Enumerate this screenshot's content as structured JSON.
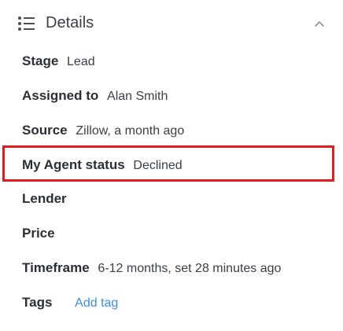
{
  "header": {
    "title": "Details",
    "list_icon": "list-icon",
    "collapse_icon": "chevron-up-icon"
  },
  "fields": {
    "stage": {
      "label": "Stage",
      "value": "Lead"
    },
    "assigned_to": {
      "label": "Assigned to",
      "value": "Alan Smith"
    },
    "source": {
      "label": "Source",
      "value": "Zillow, a month ago"
    },
    "agent_status": {
      "label": "My Agent status",
      "value": "Declined"
    },
    "lender": {
      "label": "Lender",
      "value": ""
    },
    "price": {
      "label": "Price",
      "value": ""
    },
    "timeframe": {
      "label": "Timeframe",
      "value": "6-12 months, set 28 minutes ago"
    },
    "tags": {
      "label": "Tags",
      "add_label": "Add tag"
    }
  },
  "colors": {
    "highlight_border": "#e21d1d",
    "link": "#3e8fd8"
  }
}
